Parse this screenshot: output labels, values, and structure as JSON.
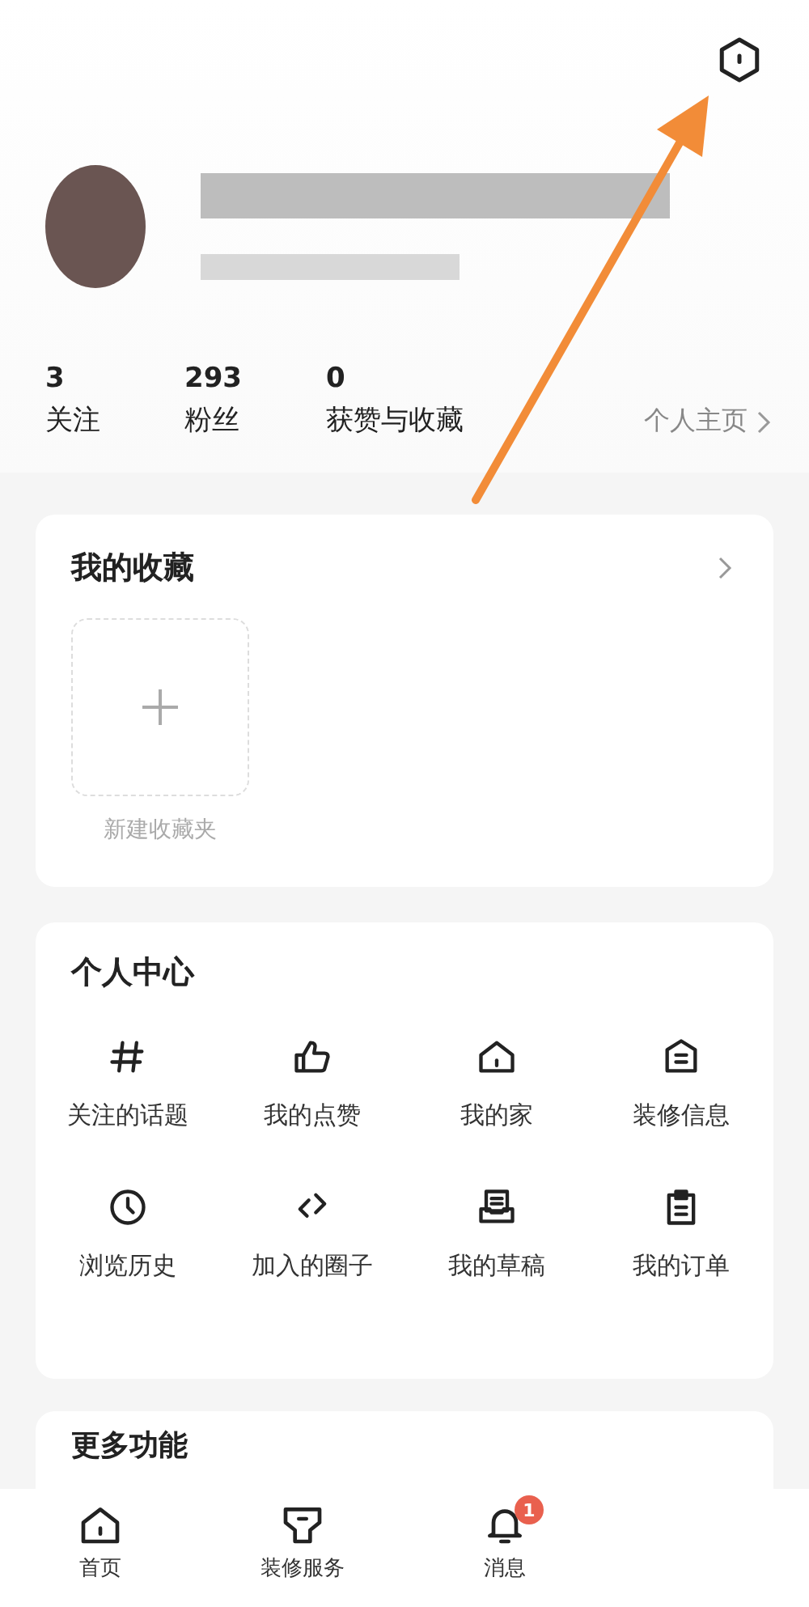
{
  "profile": {
    "stats": [
      {
        "value": "3",
        "label": "关注"
      },
      {
        "value": "293",
        "label": "粉丝"
      },
      {
        "value": "0",
        "label": "获赞与收藏"
      }
    ],
    "homepage_link": "个人主页"
  },
  "favorites": {
    "title": "我的收藏",
    "new_folder": "新建收藏夹"
  },
  "personal_center": {
    "title": "个人中心",
    "items": [
      {
        "kind": "hash",
        "label": "关注的话题"
      },
      {
        "kind": "thumb",
        "label": "我的点赞"
      },
      {
        "kind": "house",
        "label": "我的家"
      },
      {
        "kind": "doc",
        "label": "装修信息"
      },
      {
        "kind": "clock",
        "label": "浏览历史"
      },
      {
        "kind": "code",
        "label": "加入的圈子"
      },
      {
        "kind": "tray",
        "label": "我的草稿"
      },
      {
        "kind": "clipboard",
        "label": "我的订单"
      }
    ]
  },
  "more": {
    "title": "更多功能"
  },
  "bottom_nav": [
    {
      "kind": "home",
      "label": "首页"
    },
    {
      "kind": "service",
      "label": "装修服务"
    },
    {
      "kind": "bell",
      "label": "消息",
      "badge": "1"
    }
  ]
}
